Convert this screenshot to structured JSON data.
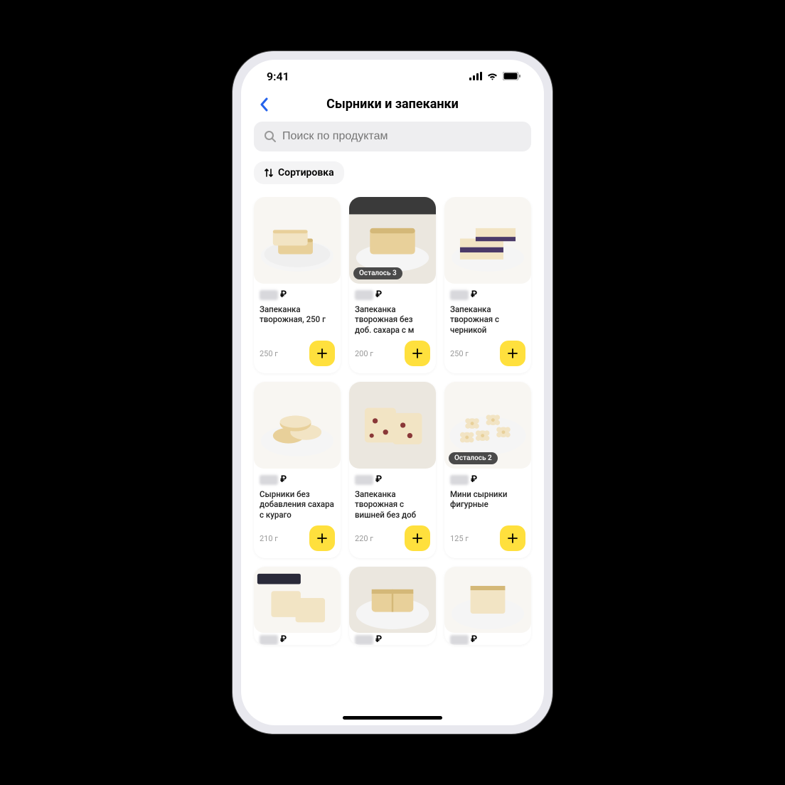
{
  "status_bar": {
    "time": "9:41"
  },
  "header": {
    "title": "Сырники и запеканки"
  },
  "search": {
    "placeholder": "Поиск по продуктам"
  },
  "sort": {
    "label": "Сортировка"
  },
  "currency": "₽",
  "products": [
    {
      "name": "Запеканка творожная, 250 г",
      "weight": "250 г",
      "badge": null
    },
    {
      "name": "Запеканка творожная без доб. сахара с м",
      "weight": "200 г",
      "badge": "Осталось 3"
    },
    {
      "name": "Запеканка творожная с черникой",
      "weight": "250 г",
      "badge": null
    },
    {
      "name": "Сырники без добавления сахара с кураго",
      "weight": "210 г",
      "badge": null
    },
    {
      "name": "Запеканка творожная с вишней без доб",
      "weight": "220 г",
      "badge": null
    },
    {
      "name": "Мини сырники фигурные",
      "weight": "125 г",
      "badge": "Осталось 2"
    }
  ],
  "food_colors": {
    "plate": "#f5f5f5",
    "plate_shadow": "#e0e0e0",
    "bg_light": "#f8f6f2",
    "bg_medium": "#ebe7df",
    "cake_light": "#f2e4c4",
    "cake_golden": "#e8d09a",
    "cake_dark": "#d4b878",
    "blueberry": "#4a3968",
    "cherry": "#8a3838"
  }
}
